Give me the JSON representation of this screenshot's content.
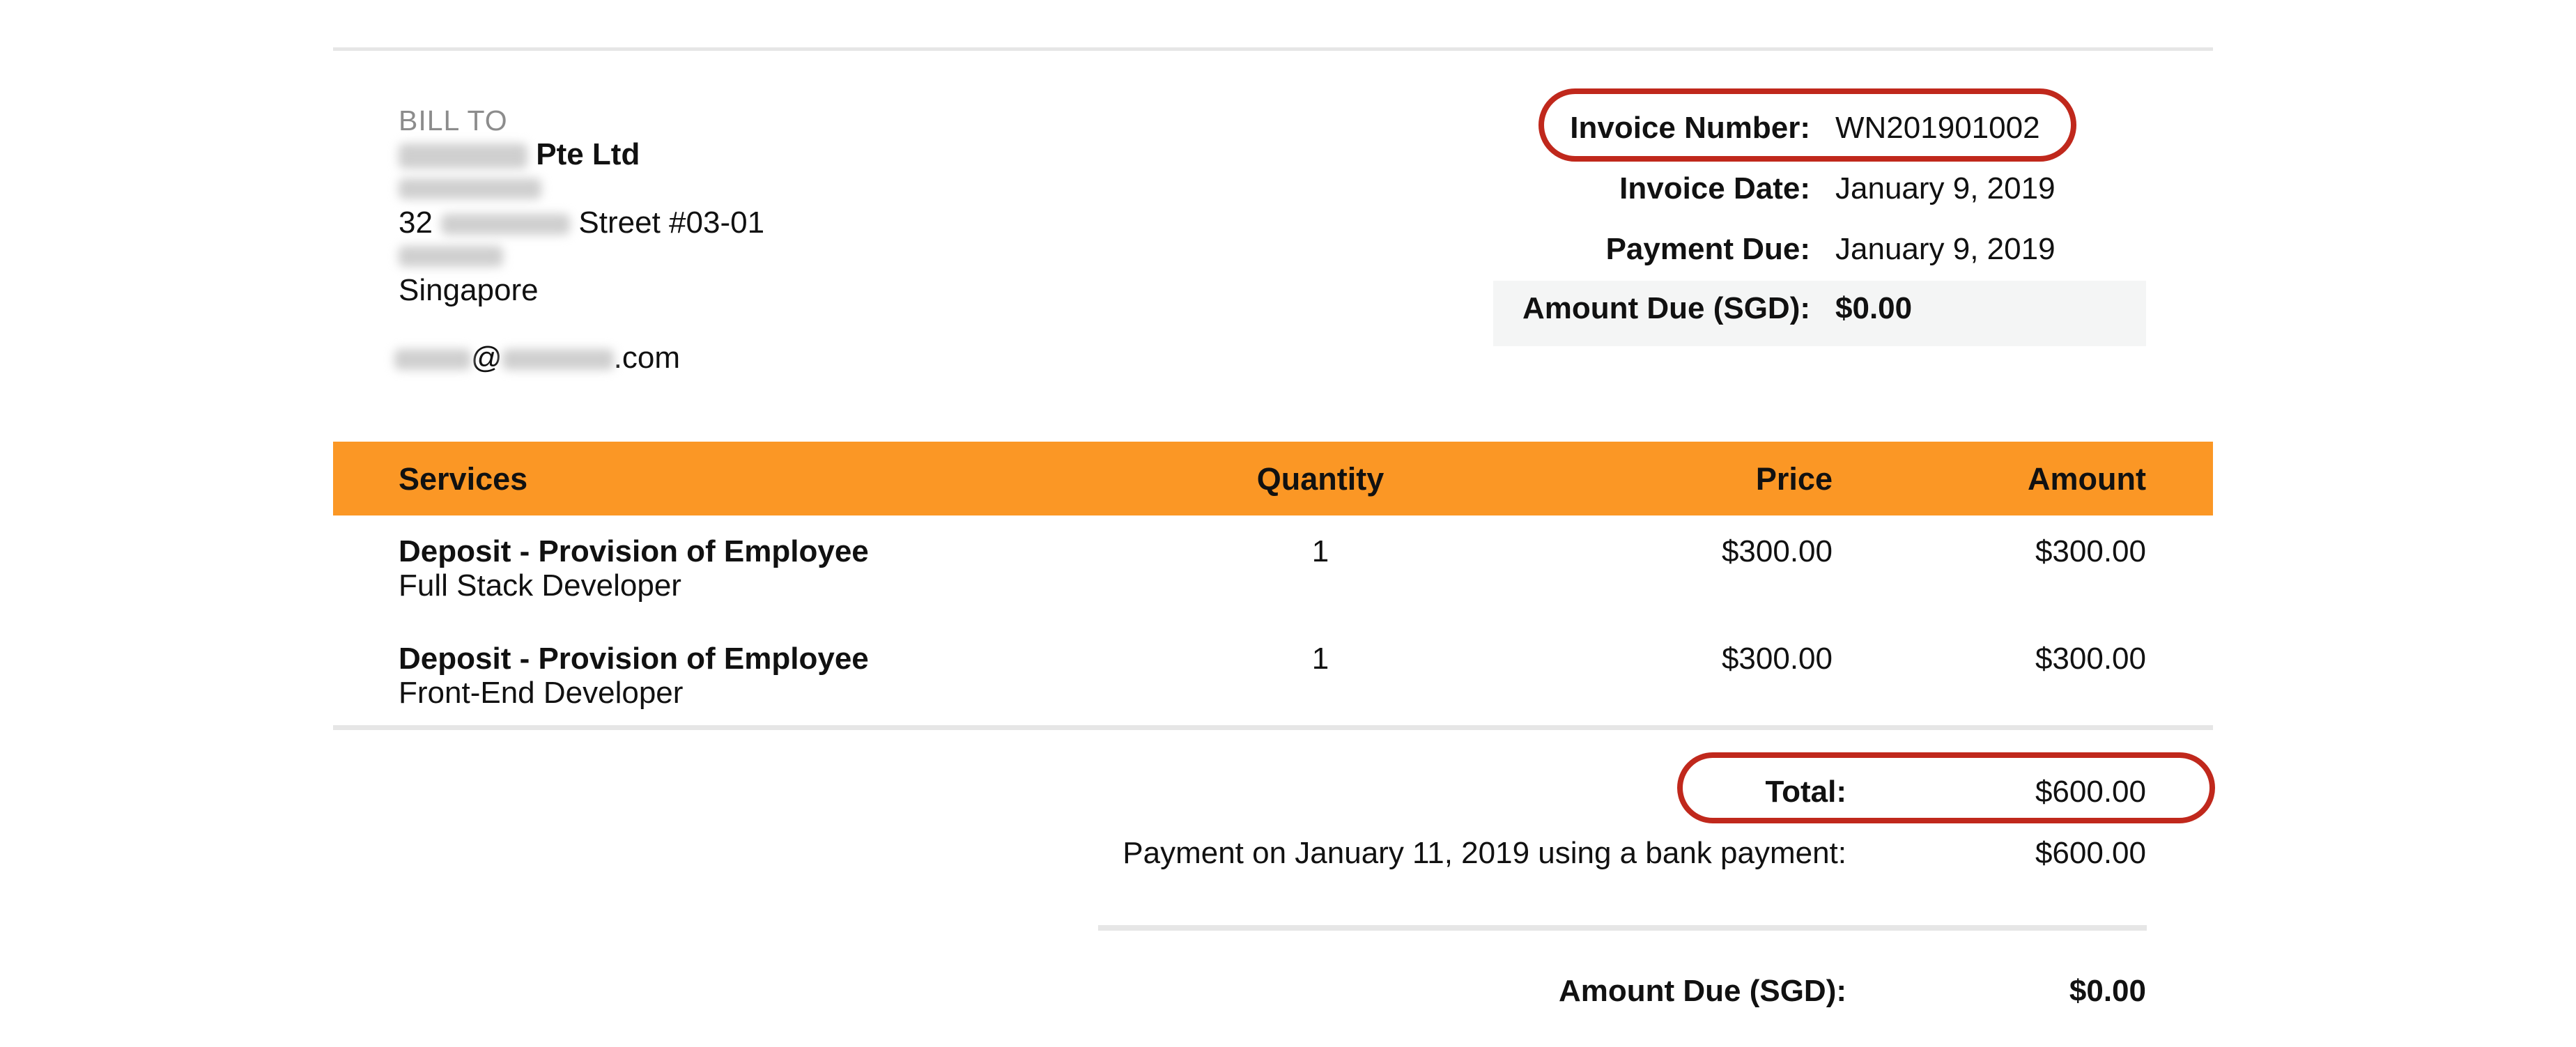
{
  "bill_to": {
    "label": "BILL TO",
    "company_suffix": "Pte Ltd",
    "address_prefix": "32",
    "address_suffix": "Street #03-01",
    "country": "Singapore",
    "email_at": "@",
    "email_domain_suffix": ".com"
  },
  "invoice_meta": {
    "number_label": "Invoice Number:",
    "number_value": "WN201901002",
    "date_label": "Invoice Date:",
    "date_value": "January 9, 2019",
    "payment_due_label": "Payment Due:",
    "payment_due_value": "January 9, 2019",
    "amount_due_label": "Amount Due (SGD):",
    "amount_due_value": "$0.00"
  },
  "table": {
    "headers": [
      "Services",
      "Quantity",
      "Price",
      "Amount"
    ],
    "rows": [
      {
        "title": "Deposit - Provision of Employee",
        "subtitle": "Full Stack Developer",
        "quantity": "1",
        "price": "$300.00",
        "amount": "$300.00"
      },
      {
        "title": "Deposit - Provision of Employee",
        "subtitle": "Front-End Developer",
        "quantity": "1",
        "price": "$300.00",
        "amount": "$300.00"
      }
    ]
  },
  "totals": {
    "total_label": "Total:",
    "total_value": "$600.00",
    "payment_label": "Payment on January 11, 2019 using a bank payment:",
    "payment_value": "$600.00",
    "amount_due_label": "Amount Due (SGD):",
    "amount_due_value": "$0.00"
  },
  "colors": {
    "header_bg": "#fb9725",
    "highlight_circle": "#c0281c"
  }
}
